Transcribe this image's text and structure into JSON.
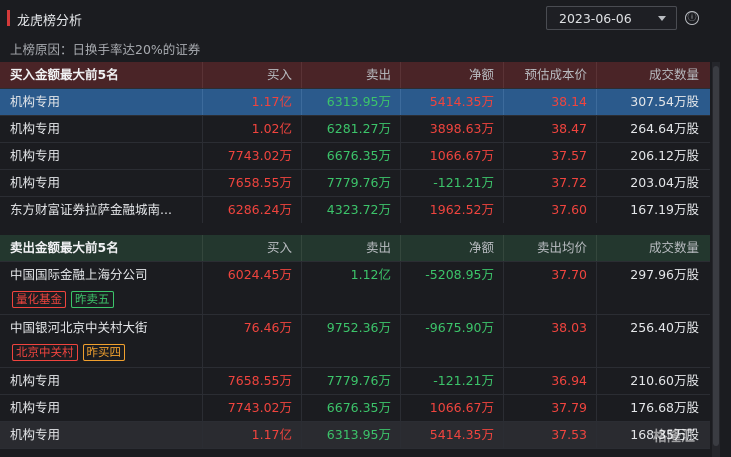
{
  "header": {
    "title": "龙虎榜分析",
    "date": "2023-06-06",
    "info_icon": "ⓘ"
  },
  "reason": "上榜原因：日换手率达20%的证券",
  "buy_table": {
    "columns": [
      "买入金额最大前5名",
      "买入",
      "卖出",
      "净额",
      "预估成本价",
      "成交数量"
    ],
    "rows": [
      {
        "name": "机构专用",
        "buy": "1.17亿",
        "sell": "6313.95万",
        "net": "5414.35万",
        "price": "38.14",
        "volume": "307.54万股"
      },
      {
        "name": "机构专用",
        "buy": "1.02亿",
        "sell": "6281.27万",
        "net": "3898.63万",
        "price": "38.47",
        "volume": "264.64万股"
      },
      {
        "name": "机构专用",
        "buy": "7743.02万",
        "sell": "6676.35万",
        "net": "1066.67万",
        "price": "37.57",
        "volume": "206.12万股"
      },
      {
        "name": "机构专用",
        "buy": "7658.55万",
        "sell": "7779.76万",
        "net": "-121.21万",
        "price": "37.72",
        "volume": "203.04万股"
      },
      {
        "name": "东方财富证券拉萨金融城南...",
        "buy": "6286.24万",
        "sell": "4323.72万",
        "net": "1962.52万",
        "price": "37.60",
        "volume": "167.19万股"
      }
    ]
  },
  "sell_table": {
    "columns": [
      "卖出金额最大前5名",
      "买入",
      "卖出",
      "净额",
      "卖出均价",
      "成交数量"
    ],
    "rows": [
      {
        "name": "中国国际金融上海分公司",
        "buy": "6024.45万",
        "sell": "1.12亿",
        "net": "-5208.95万",
        "price": "37.70",
        "volume": "297.96万股",
        "tags": [
          "量化基金",
          "昨卖五"
        ]
      },
      {
        "name": "中国银河北京中关村大街",
        "buy": "76.46万",
        "sell": "9752.36万",
        "net": "-9675.90万",
        "price": "38.03",
        "volume": "256.40万股",
        "tags": [
          "北京中关村",
          "昨买四"
        ]
      },
      {
        "name": "机构专用",
        "buy": "7658.55万",
        "sell": "7779.76万",
        "net": "-121.21万",
        "price": "36.94",
        "volume": "210.60万股"
      },
      {
        "name": "机构专用",
        "buy": "7743.02万",
        "sell": "6676.35万",
        "net": "1066.67万",
        "price": "37.79",
        "volume": "176.68万股"
      },
      {
        "name": "机构专用",
        "buy": "1.17亿",
        "sell": "6313.95万",
        "net": "5414.35万",
        "price": "37.53",
        "volume": "168.35万股"
      }
    ]
  },
  "watermark": "格隆汇"
}
